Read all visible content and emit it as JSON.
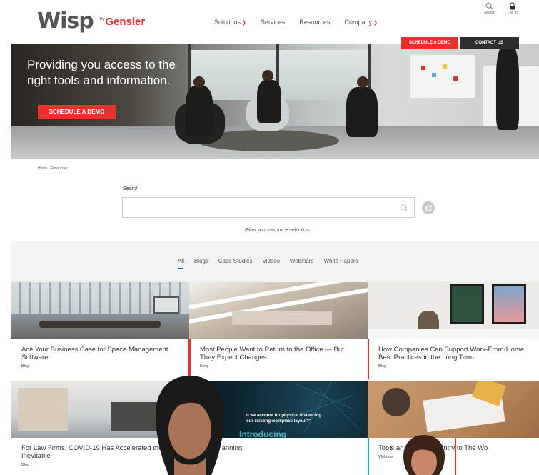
{
  "header": {
    "logo": "Wisp",
    "partner_by": "by",
    "partner": "Gensler",
    "nav": [
      {
        "label": "Solutions",
        "caret": true
      },
      {
        "label": "Services",
        "caret": false
      },
      {
        "label": "Resources",
        "caret": false
      },
      {
        "label": "Company",
        "caret": true
      }
    ],
    "search_label": "Search",
    "login_label": "Log in",
    "schedule_demo_label": "SCHEDULE A DEMO",
    "contact_label": "CONTACT US"
  },
  "hero": {
    "line1": "Providing you access to the",
    "line2": "right tools and information.",
    "cta": "SCHEDULE A DEMO"
  },
  "breadcrumb": "Home / Resources",
  "search": {
    "label": "Search",
    "placeholder": "",
    "filter_hint": "Filter your resource selection:"
  },
  "tabs": [
    "All",
    "Blogs",
    "Case Studies",
    "Videos",
    "Webinars",
    "White Papers"
  ],
  "active_tab": "All",
  "cards": [
    {
      "title": "Ace Your Business Case for Space Management Software",
      "type": "Blog"
    },
    {
      "title": "Most People Want to Return to the Office — But They Expect Changes",
      "type": "Blog"
    },
    {
      "title": "How Companies Can Support Work-From-Home Best Practices in the Long Term",
      "type": "Blog"
    },
    {
      "title": "For Law Firms, COVID-19 Has Accelerated the Inevitable",
      "type": "Blog"
    },
    {
      "title": "acity Planning",
      "type": ""
    },
    {
      "title": "Tools an to Plan Re Entry to The Wo",
      "type": "Webinar"
    }
  ],
  "card_overlay_text": {
    "line1": "n we account for physical distancing",
    "line2": "our existing workplace layout?\"",
    "line3": "Introducing"
  },
  "colors": {
    "brand_red": "#e8302e",
    "dark": "#2e2e2e",
    "active_tab_underline": "#1f5da8",
    "webinar_accent": "#1aa3c8"
  }
}
